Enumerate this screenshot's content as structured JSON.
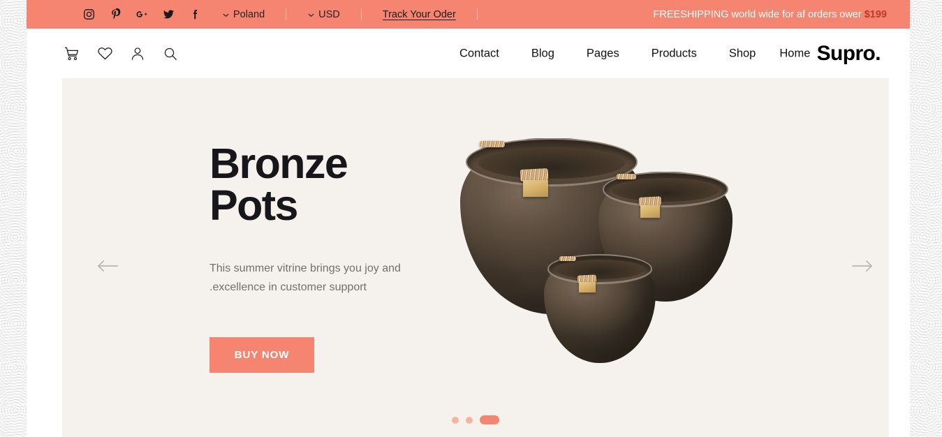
{
  "topbar": {
    "social": [
      {
        "name": "instagram-icon",
        "label": "Instagram"
      },
      {
        "name": "pinterest-icon",
        "label": "Pinterest"
      },
      {
        "name": "google-plus-icon",
        "label": "Google Plus"
      },
      {
        "name": "twitter-icon",
        "label": "Twitter"
      },
      {
        "name": "facebook-icon",
        "label": "Facebook"
      }
    ],
    "country": "Poland",
    "currency": "USD",
    "track_order": "Track Your Oder",
    "shipping_text": "FREESHIPPING world wide for af orders ower ",
    "shipping_amount": "$199",
    "bg_color": "#F58570",
    "amount_color": "#C0392B"
  },
  "header": {
    "icons": [
      {
        "name": "cart-icon",
        "label": "Cart"
      },
      {
        "name": "wishlist-heart-icon",
        "label": "Wishlist"
      },
      {
        "name": "account-user-icon",
        "label": "Account"
      },
      {
        "name": "search-icon",
        "label": "Search"
      }
    ],
    "nav": [
      {
        "label": "Contact"
      },
      {
        "label": "Blog"
      },
      {
        "label": "Pages"
      },
      {
        "label": "Products"
      },
      {
        "label": "Shop"
      },
      {
        "label": "Home"
      }
    ],
    "logo": "Supro."
  },
  "hero": {
    "title": "Bronze\nPots",
    "subtitle": "This summer vitrine brings you joy and\n.excellence in customer support",
    "cta_label": "BUY NOW",
    "bg_color": "#F5F1EC",
    "cta_color": "#F58570",
    "prev_label": "Previous slide",
    "next_label": "Next slide",
    "slides": [
      {
        "active": false
      },
      {
        "active": false
      },
      {
        "active": true
      }
    ],
    "product_alt": "Three bronze pots with rattan-wrapped handles and brass plates"
  }
}
